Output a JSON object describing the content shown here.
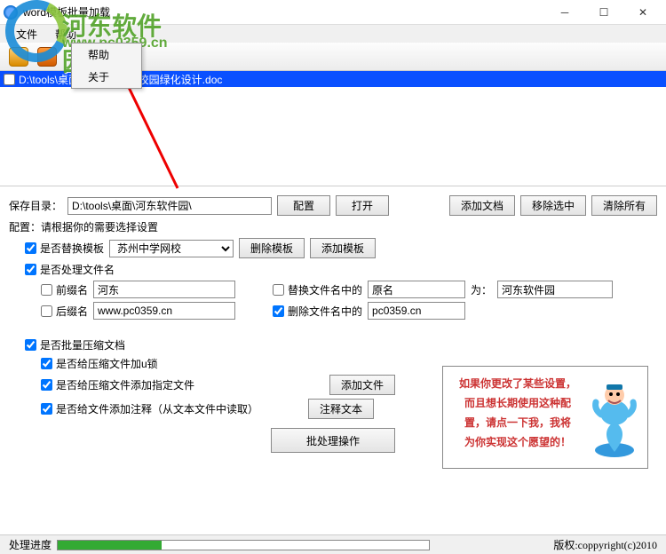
{
  "window": {
    "title": "word模板批量加载"
  },
  "menubar": {
    "file": "文件",
    "help": "帮助"
  },
  "helpmenu": {
    "help": "帮助",
    "about": "关于"
  },
  "filelist": {
    "item0": "D:\\tools\\桌面\\河东软件园\\校园绿化设计.doc"
  },
  "watermark": {
    "line1": "河东软件园",
    "line2": "www.pc0359.cn"
  },
  "savedir": {
    "label": "保存目录：",
    "path": "D:\\tools\\桌面\\河东软件园\\",
    "config": "配置",
    "open": "打开",
    "adddoc": "添加文档",
    "removesel": "移除选中",
    "clearall": "清除所有"
  },
  "config": {
    "title": "配置：请根据你的需要选择设置",
    "replaceTemplate": {
      "label": "是否替换模板",
      "value": "苏州中学网校",
      "delete": "删除模板",
      "add": "添加模板"
    },
    "processFilename": {
      "label": "是否处理文件名",
      "prefix": {
        "label": "前缀名",
        "value": "河东"
      },
      "suffix": {
        "label": "后缀名",
        "value": "www.pc0359.cn"
      },
      "replaceIn": {
        "label": "替换文件名中的",
        "from": "原名",
        "to_label": "为：",
        "to": "河东软件园"
      },
      "deleteIn": {
        "label": "删除文件名中的",
        "value": "pc0359.cn"
      }
    },
    "compress": {
      "label": "是否批量压缩文档",
      "lock": "是否给压缩文件加u锁",
      "addfile": "是否给压缩文件添加指定文件",
      "addfile_btn": "添加文件",
      "comment": "是否给文件添加注释（从文本文件中读取）",
      "comment_btn": "注释文本"
    }
  },
  "info": {
    "line1": "如果你更改了某些设置，",
    "line2": "而且想长期使用这种配",
    "line3": "置，请点一下我，我将",
    "line4": "为你实现这个愿望的！"
  },
  "batch": "批处理操作",
  "status": {
    "label": "处理进度",
    "copyright": "版权:coppyright(c)2010"
  }
}
